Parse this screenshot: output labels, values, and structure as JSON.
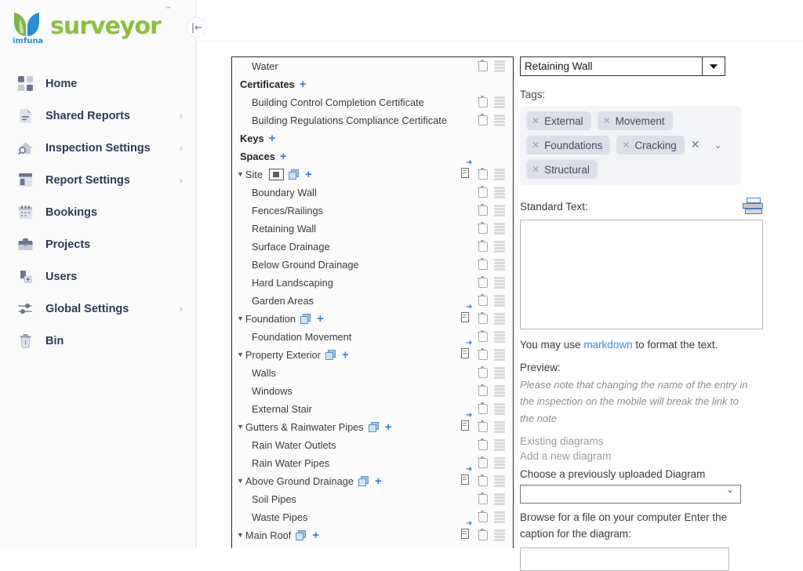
{
  "brand": {
    "name": "surveyor",
    "tm": "™",
    "sub": "imfuna"
  },
  "collapse_button": {
    "icon": "collapse-left-icon",
    "glyph": "|←"
  },
  "sidebar": {
    "items": [
      {
        "label": "Home",
        "icon": "grid-icon",
        "chevron": ""
      },
      {
        "label": "Shared Reports",
        "icon": "document-share-icon",
        "chevron": "›"
      },
      {
        "label": "Inspection Settings",
        "icon": "house-search-icon",
        "chevron": "›"
      },
      {
        "label": "Report Settings",
        "icon": "layout-icon",
        "chevron": "›"
      },
      {
        "label": "Bookings",
        "icon": "calendar-icon",
        "chevron": ""
      },
      {
        "label": "Projects",
        "icon": "briefcase-icon",
        "chevron": ""
      },
      {
        "label": "Users",
        "icon": "user-add-icon",
        "chevron": ""
      },
      {
        "label": "Global Settings",
        "icon": "sliders-icon",
        "chevron": "›"
      },
      {
        "label": "Bin",
        "icon": "trash-icon",
        "chevron": ""
      }
    ]
  },
  "tree": {
    "rows": [
      {
        "label": "Water",
        "type": "child",
        "trash": true,
        "drag": true
      },
      {
        "label": "Certificates",
        "type": "group",
        "plus": "+"
      },
      {
        "label": "Building Control Completion Certificate",
        "type": "child",
        "trash": true,
        "drag": true
      },
      {
        "label": "Building Regulations Compliance Certificate",
        "type": "child",
        "trash": true,
        "drag": true
      },
      {
        "label": "Keys",
        "type": "group",
        "plus": "+"
      },
      {
        "label": "Spaces",
        "type": "group",
        "plus": "+"
      },
      {
        "label": "Site",
        "type": "expand",
        "caret": "▼",
        "frame": true,
        "copy": true,
        "plus": "+",
        "doc": true,
        "trash": true,
        "drag": true
      },
      {
        "label": "Boundary Wall",
        "type": "child",
        "trash": true,
        "drag": true
      },
      {
        "label": "Fences/Railings",
        "type": "child",
        "trash": true,
        "drag": true
      },
      {
        "label": "Retaining Wall",
        "type": "child",
        "trash": true,
        "drag": true
      },
      {
        "label": "Surface Drainage",
        "type": "child",
        "trash": true,
        "drag": true
      },
      {
        "label": "Below Ground Drainage",
        "type": "child",
        "trash": true,
        "drag": true
      },
      {
        "label": "Hard Landscaping",
        "type": "child",
        "trash": true,
        "drag": true
      },
      {
        "label": "Garden Areas",
        "type": "child",
        "trash": true,
        "drag": true
      },
      {
        "label": "Foundation",
        "type": "expand",
        "caret": "▼",
        "copy": true,
        "plus": "+",
        "doc": true,
        "trash": true,
        "drag": true
      },
      {
        "label": "Foundation Movement",
        "type": "child",
        "trash": true,
        "drag": true
      },
      {
        "label": "Property Exterior",
        "type": "expand",
        "caret": "▼",
        "copy": true,
        "plus": "+",
        "doc": true,
        "trash": true,
        "drag": true
      },
      {
        "label": "Walls",
        "type": "child",
        "trash": true,
        "drag": true
      },
      {
        "label": "Windows",
        "type": "child",
        "trash": true,
        "drag": true
      },
      {
        "label": "External Stair",
        "type": "child",
        "trash": true,
        "drag": true
      },
      {
        "label": "Gutters & Rainwater Pipes",
        "type": "expand",
        "caret": "▼",
        "copy": true,
        "plus": "+",
        "doc": true,
        "trash": true,
        "drag": true
      },
      {
        "label": "Rain Water Outlets",
        "type": "child",
        "trash": true,
        "drag": true
      },
      {
        "label": "Rain Water Pipes",
        "type": "child",
        "trash": true,
        "drag": true
      },
      {
        "label": "Above Ground Drainage",
        "type": "expand",
        "caret": "▼",
        "copy": true,
        "plus": "+",
        "doc": true,
        "trash": true,
        "drag": true
      },
      {
        "label": "Soil Pipes",
        "type": "child",
        "trash": true,
        "drag": true
      },
      {
        "label": "Waste Pipes",
        "type": "child",
        "trash": true,
        "drag": true
      },
      {
        "label": "Main Roof",
        "type": "expand",
        "caret": "▼",
        "copy": true,
        "plus": "+",
        "doc": true,
        "trash": true,
        "drag": true
      }
    ]
  },
  "detail": {
    "entry_select": {
      "value": "Retaining Wall",
      "icon": "dropdown-arrow-icon"
    },
    "tags_label": "Tags:",
    "tags": [
      "External",
      "Movement",
      "Foundations",
      "Cracking",
      "Structural"
    ],
    "tag_clear_glyph": "✕",
    "tag_chev_glyph": "⌄",
    "standard_text_label": "Standard Text:",
    "standard_text_value": "",
    "standard_text_icon": "insert-standard-text-icon",
    "markdown_prefix": "You may use ",
    "markdown_link": "markdown",
    "markdown_suffix": " to format the text.",
    "preview_label": "Preview:",
    "preview_text": "Please note that changing the name of the entry in the inspection on the mobile will break the link to the note",
    "existing_diagrams": "Existing diagrams",
    "add_new_diagram": "Add a new diagram",
    "choose_diagram_label": "Choose a previously uploaded Diagram",
    "diagram_select_value": "",
    "browse_text": "Browse for a file on your computer Enter the caption for the diagram:",
    "caption_value": ""
  }
}
